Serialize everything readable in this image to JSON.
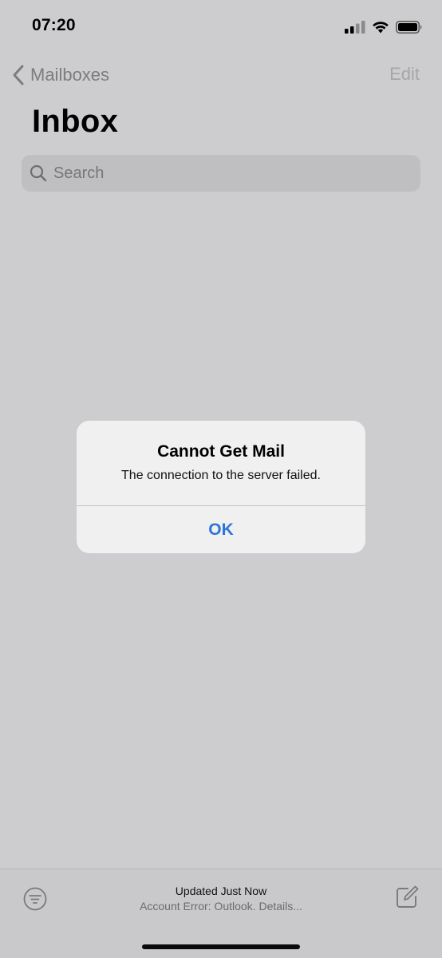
{
  "status_bar": {
    "time": "07:20",
    "icons": [
      "signal-icon",
      "wifi-icon",
      "battery-icon"
    ]
  },
  "nav": {
    "back_label": "Mailboxes",
    "edit_label": "Edit"
  },
  "page": {
    "title": "Inbox"
  },
  "search": {
    "placeholder": "Search"
  },
  "alert": {
    "title": "Cannot Get Mail",
    "message": "The connection to the server failed.",
    "button_label": "OK"
  },
  "toolbar": {
    "status_primary": "Updated Just Now",
    "status_secondary": "Account Error: Outlook. Details...",
    "icons": [
      "filter-icon",
      "compose-icon"
    ]
  },
  "colors": {
    "accent": "#2f74d9",
    "background": "#cdcdcf",
    "alert_background": "#f0f0f1"
  }
}
